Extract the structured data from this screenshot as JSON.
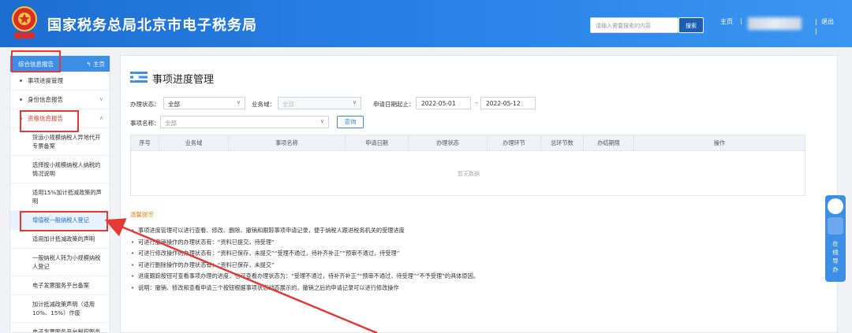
{
  "header": {
    "site_title": "国家税务总局北京市电子税务局",
    "search_placeholder": "请输入需要搜索的内容",
    "search_button": "搜索",
    "home_link": "主页",
    "exit_link": "退出",
    "separator": "|"
  },
  "sidebar": {
    "header_title": "综合信息报告",
    "header_home": "主页",
    "items": [
      {
        "label": "事项进度管理"
      },
      {
        "label": "身份信息报告"
      },
      {
        "label": "资格信息报告"
      }
    ],
    "sub_items": [
      {
        "label": "货运小规模纳税人异地代开专票备案"
      },
      {
        "label": "选择按小规模纳税人纳税的情况说明"
      },
      {
        "label": "适用15%加计抵减政策的声明"
      },
      {
        "label": "增值税一般纳税人登记"
      },
      {
        "label": "适用加计抵减政策的声明"
      },
      {
        "label": "一般纳税人转为小规模纳税人登记"
      },
      {
        "label": "电子发票服务平台备案"
      },
      {
        "label": "加计抵减政策声明（适用10%、15%）作废"
      },
      {
        "label": "电子发票服务平台税控服务"
      }
    ],
    "chevron_down": "∨",
    "chevron_up": "∧"
  },
  "main": {
    "title": "事项进度管理",
    "filters": {
      "status_label": "办理状态：",
      "status_value": "全部",
      "domain_label": "业务域：",
      "domain_value": "全部",
      "date_label": "申请日期起止：",
      "date_start": "2022-05-01",
      "date_sep": "-",
      "date_end": "2022-05-12",
      "name_label": "事项名称：",
      "name_value": "全部",
      "query_button": "查询"
    },
    "table": {
      "columns": [
        "序号",
        "业务域",
        "事项名称",
        "申请日期",
        "办理状态",
        "办理环节",
        "总环节数",
        "办结期限",
        "操作"
      ],
      "empty_text": "暂无数据"
    },
    "tips": {
      "title": "温馨提示",
      "lines": [
        "事项进度管理可以进行查看、修改、删除、撤销和跟踪事项申请记录，便于纳税人跟进税务机关的受理进度",
        "可进行撤销操作的办理状态有：“资料已提交，待受理”",
        "可进行修改操作的办理状态有：“资料已保存，未提交”“受理不通过，待补齐补正”“预审不通过，待受理”",
        "可进行删除操作的办理状态有：“资料已保存，未提交”",
        "进度跟踪按钮可查看事项办理的进度，也可查看办理状态为：“受理不通过，待补齐补正”“预审不通过，待受理”“不予受理”的具体原因。",
        "说明：撤销、修改和查看申请三个按钮根据事项状态动态展示的，撤销之后的申请记录可以进行修改操作"
      ]
    }
  },
  "float_panel": {
    "label_line1": "在",
    "label_line2": "线",
    "label_line3": "导",
    "label_line4": "办"
  },
  "colors": {
    "header_blue": "#2a83e8",
    "accent_blue": "#3d8ee6",
    "highlight_red": "#e53935",
    "tips_orange": "#e08a1e"
  }
}
